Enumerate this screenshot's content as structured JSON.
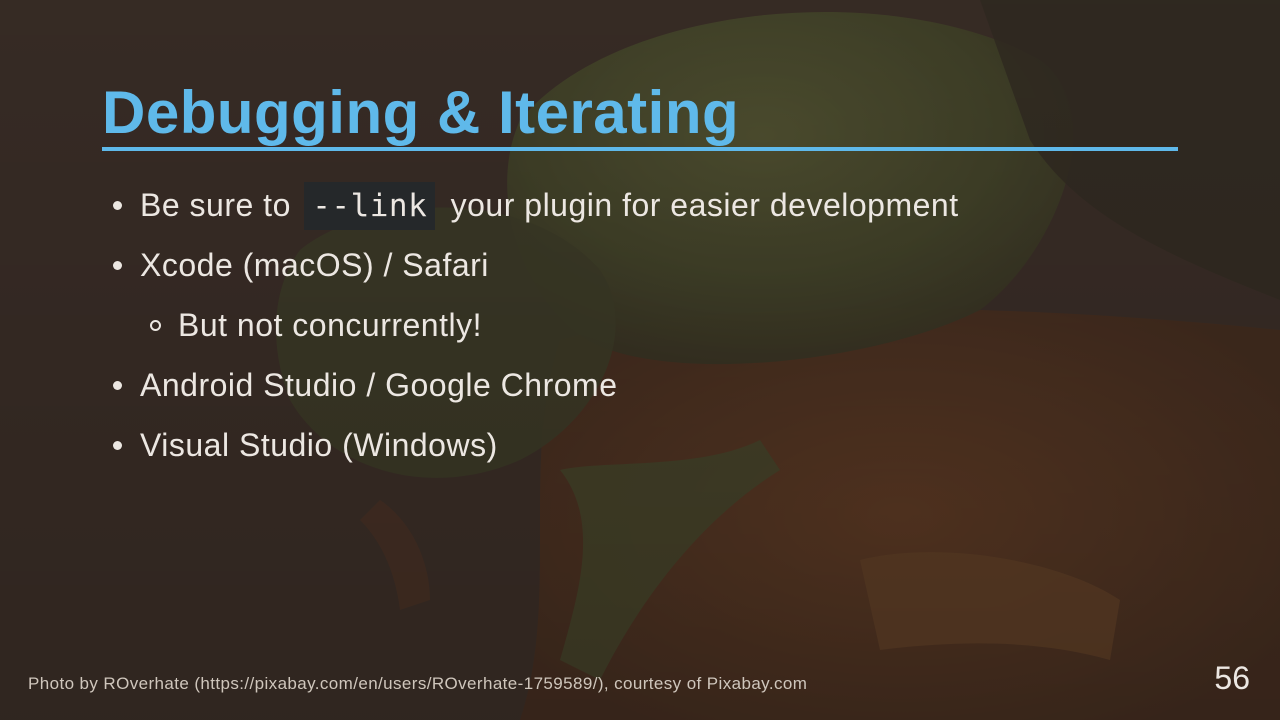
{
  "slide": {
    "title": "Debugging & Iterating",
    "bullets": {
      "b1_before": "Be sure to",
      "b1_code": "--link",
      "b1_after": "your plugin for easier development",
      "b2": "Xcode (macOS) / Safari",
      "b2_sub": "But not concurrently!",
      "b3": "Android Studio / Google Chrome",
      "b4": "Visual Studio (Windows)"
    },
    "credit": "Photo by ROverhate (https://pixabay.com/en/users/ROverhate-1759589/), courtesy of Pixabay.com",
    "page_number": "56"
  },
  "colors": {
    "accent": "#5fb9ea",
    "text": "#ece7e2",
    "background": "#3b2f28",
    "code_background": "#25282a"
  },
  "background_image": "beetle-macro-photo"
}
